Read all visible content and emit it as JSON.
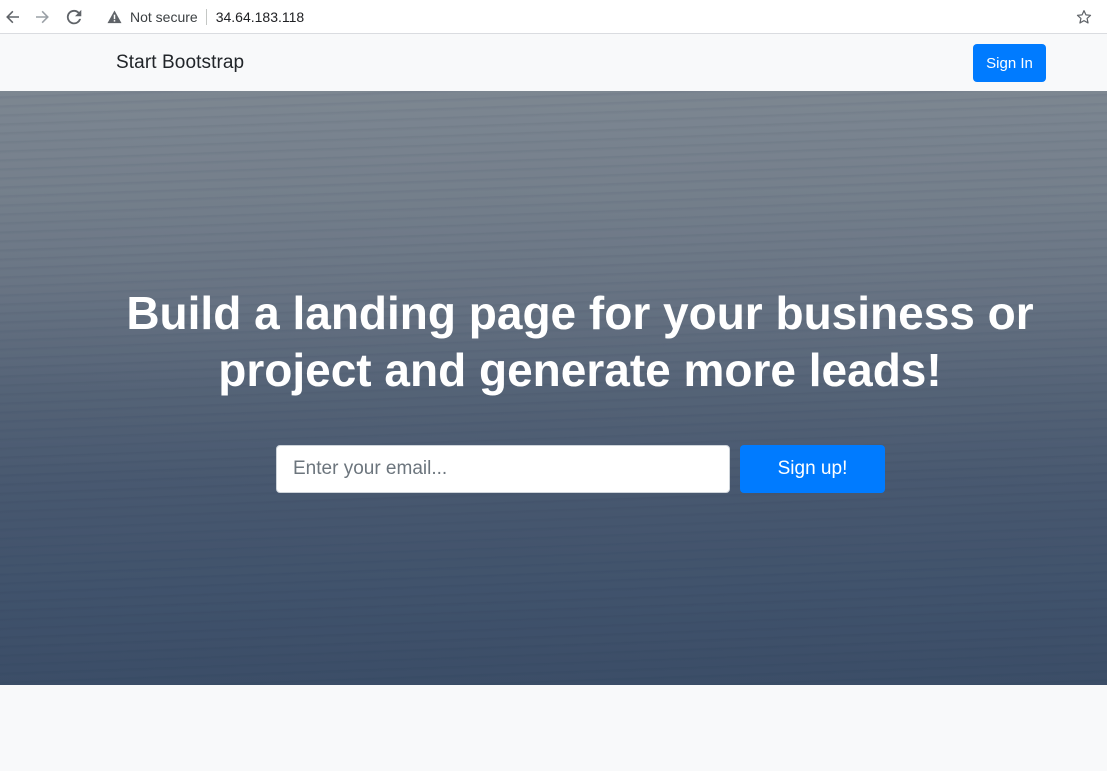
{
  "browser": {
    "security_label": "Not secure",
    "url": "34.64.183.118",
    "icons": {
      "back": "back-arrow-icon",
      "forward": "forward-arrow-icon",
      "reload": "reload-icon",
      "security": "warning-icon",
      "bookmark": "star-icon"
    }
  },
  "navbar": {
    "brand": "Start Bootstrap",
    "signin_label": "Sign In"
  },
  "masthead": {
    "headline": "Build a landing page for your business or project and generate more leads!",
    "email_placeholder": "Enter your email...",
    "email_value": "",
    "signup_label": "Sign up!"
  },
  "colors": {
    "primary": "#007bff",
    "navbar_bg": "#f8f9fa",
    "brand_text": "#212529"
  }
}
